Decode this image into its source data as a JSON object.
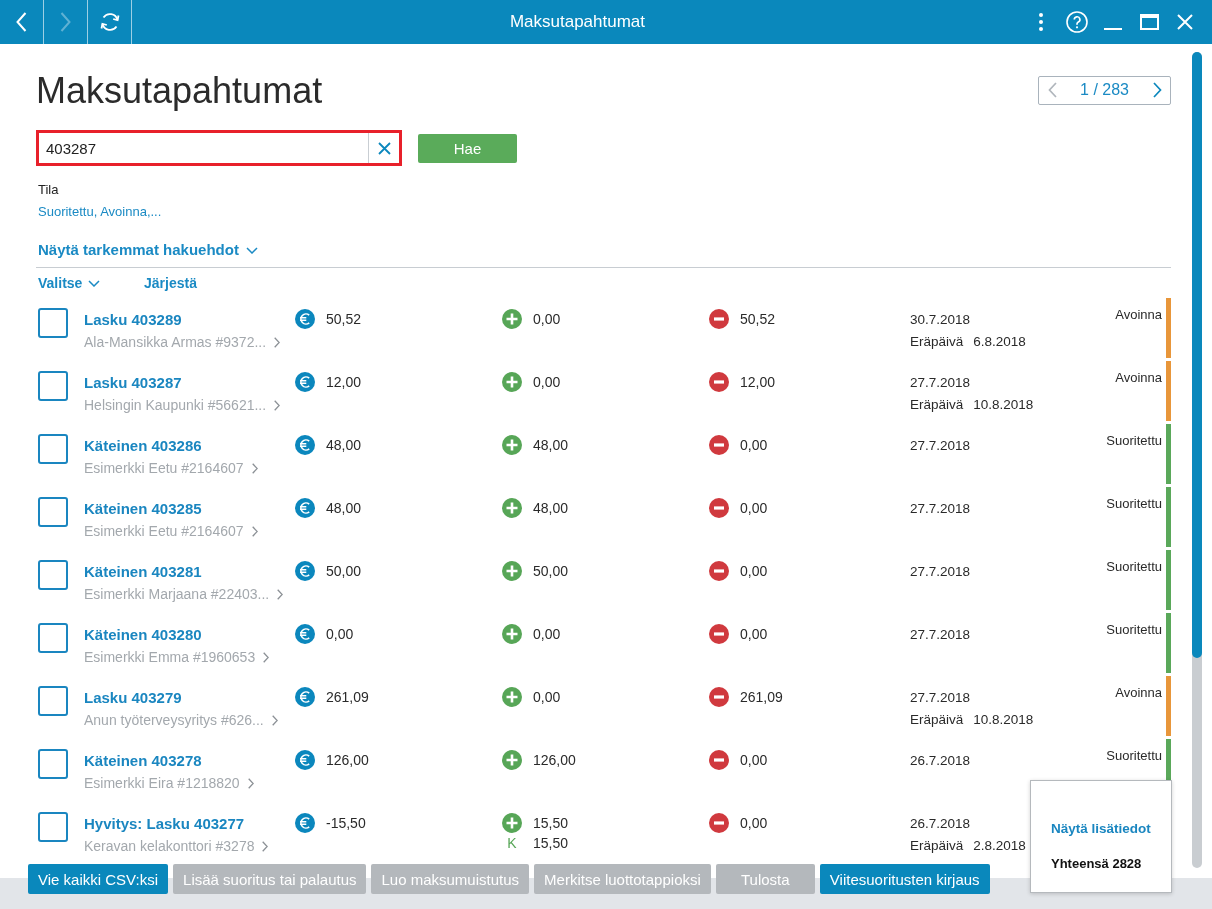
{
  "window": {
    "title": "Maksutapahtumat"
  },
  "nav_buttons": [
    {
      "kind": "back",
      "disabled": false
    },
    {
      "kind": "forward",
      "disabled": true
    },
    {
      "kind": "refresh",
      "disabled": false
    }
  ],
  "window_controls": [
    {
      "kind": "more"
    },
    {
      "kind": "help"
    },
    {
      "kind": "minimize"
    },
    {
      "kind": "maximize"
    },
    {
      "kind": "close"
    }
  ],
  "page": {
    "title": "Maksutapahtumat"
  },
  "pager": {
    "text": "1 / 283",
    "prev_disabled": true,
    "next_disabled": false
  },
  "search": {
    "value": "403287",
    "highlighted": true,
    "button": "Hae"
  },
  "filter": {
    "label": "Tila",
    "value": "Suoritettu, Avoinna,..."
  },
  "advanced_link": {
    "label": "Näytä tarkemmat hakuehdot",
    "expanded": false
  },
  "toolbar": [
    {
      "label": "Valitse",
      "kind": "dropdown"
    },
    {
      "label": "Järjestä",
      "kind": "link"
    }
  ],
  "rows": [
    {
      "checked": false,
      "title": "Lasku 403289",
      "customer": "Ala-Mansikka Armas #9372...",
      "amount": "50,52",
      "paid": "0,00",
      "open": "50,52",
      "date": "30.7.2018",
      "due_label": "Eräpäivä",
      "due_date": "6.8.2018",
      "status": "Avoinna",
      "color": "#e8963a"
    },
    {
      "checked": false,
      "title": "Lasku 403287",
      "customer": "Helsingin Kaupunki #56621...",
      "amount": "12,00",
      "paid": "0,00",
      "open": "12,00",
      "date": "27.7.2018",
      "due_label": "Eräpäivä",
      "due_date": "10.8.2018",
      "status": "Avoinna",
      "color": "#e8963a"
    },
    {
      "checked": false,
      "title": "Käteinen 403286",
      "customer": "Esimerkki Eetu #2164607",
      "amount": "48,00",
      "paid": "48,00",
      "open": "0,00",
      "date": "27.7.2018",
      "status": "Suoritettu",
      "color": "#5aa85a"
    },
    {
      "checked": false,
      "title": "Käteinen 403285",
      "customer": "Esimerkki Eetu #2164607",
      "amount": "48,00",
      "paid": "48,00",
      "open": "0,00",
      "date": "27.7.2018",
      "status": "Suoritettu",
      "color": "#5aa85a"
    },
    {
      "checked": false,
      "title": "Käteinen 403281",
      "customer": "Esimerkki Marjaana #22403...",
      "amount": "50,00",
      "paid": "50,00",
      "open": "0,00",
      "date": "27.7.2018",
      "status": "Suoritettu",
      "color": "#5aa85a"
    },
    {
      "checked": false,
      "title": "Käteinen 403280",
      "customer": "Esimerkki Emma #1960653",
      "amount": "0,00",
      "paid": "0,00",
      "open": "0,00",
      "date": "27.7.2018",
      "status": "Suoritettu",
      "color": "#5aa85a"
    },
    {
      "checked": false,
      "title": "Lasku 403279",
      "customer": "Anun työterveysyritys #626...",
      "amount": "261,09",
      "paid": "0,00",
      "open": "261,09",
      "date": "27.7.2018",
      "due_label": "Eräpäivä",
      "due_date": "10.8.2018",
      "status": "Avoinna",
      "color": "#e8963a"
    },
    {
      "checked": false,
      "title": "Käteinen 403278",
      "customer": "Esimerkki Eira #1218820",
      "amount": "126,00",
      "paid": "126,00",
      "open": "0,00",
      "date": "26.7.2018",
      "status": "Suoritettu",
      "color": "#5aa85a"
    },
    {
      "checked": false,
      "title": "Hyvitys: Lasku 403277",
      "customer": "Keravan kelakonttori #3278",
      "amount": "-15,50",
      "paid": "15,50",
      "extra_payment": {
        "marker": "K",
        "amount": "15,50"
      },
      "open": "0,00",
      "date": "26.7.2018",
      "due_label": "Eräpäivä",
      "due_date": "2.8.2018"
    }
  ],
  "footer_buttons": [
    {
      "label": "Vie kaikki CSV:ksi",
      "disabled": false
    },
    {
      "label": "Lisää suoritus tai palautus",
      "disabled": true
    },
    {
      "label": "Luo maksumuistutus",
      "disabled": true
    },
    {
      "label": "Merkitse luottotappioksi",
      "disabled": true
    },
    {
      "label": "Tulosta",
      "disabled": true
    },
    {
      "label": "Viitesuoritusten kirjaus",
      "disabled": false
    }
  ],
  "summary_popup": {
    "link": "Näytä lisätiedot",
    "total": "Yhteensä 2828"
  }
}
